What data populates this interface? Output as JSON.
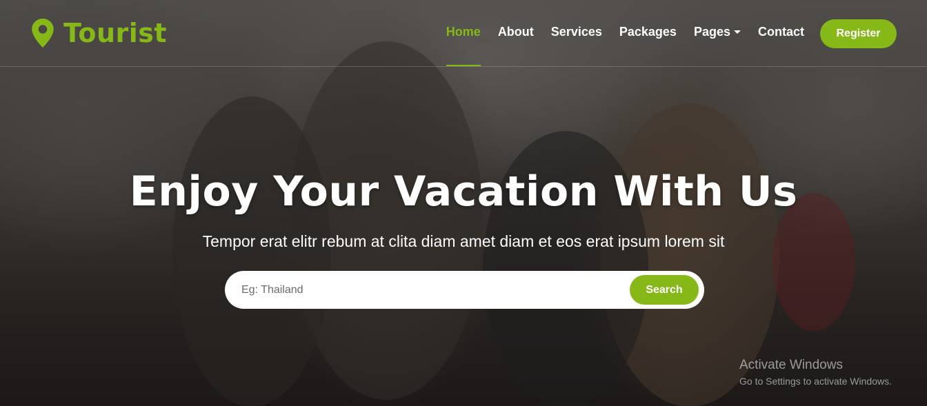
{
  "brand": {
    "name": "Tourist",
    "icon": "map-pin-icon",
    "color": "#86b817"
  },
  "nav": {
    "items": [
      {
        "label": "Home",
        "active": true
      },
      {
        "label": "About",
        "active": false
      },
      {
        "label": "Services",
        "active": false
      },
      {
        "label": "Packages",
        "active": false
      },
      {
        "label": "Pages",
        "active": false,
        "dropdown": true
      },
      {
        "label": "Contact",
        "active": false
      }
    ],
    "register_label": "Register"
  },
  "hero": {
    "title": "Enjoy Your Vacation With Us",
    "subtitle": "Tempor erat elitr rebum at clita diam amet diam et eos erat ipsum lorem sit"
  },
  "search": {
    "placeholder": "Eg: Thailand",
    "button_label": "Search"
  },
  "watermark": {
    "title": "Activate Windows",
    "subtitle": "Go to Settings to activate Windows."
  },
  "colors": {
    "accent": "#86b817",
    "text": "#ffffff"
  }
}
